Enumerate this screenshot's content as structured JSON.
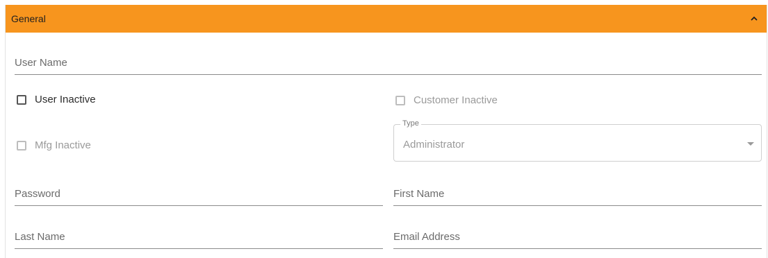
{
  "section": {
    "title": "General",
    "expanded": true,
    "accent_color": "#f7951e"
  },
  "fields": {
    "user_name": {
      "label": "User Name",
      "value": ""
    },
    "password": {
      "label": "Password",
      "value": ""
    },
    "first_name": {
      "label": "First Name",
      "value": ""
    },
    "last_name": {
      "label": "Last Name",
      "value": ""
    },
    "email_address": {
      "label": "Email Address",
      "value": ""
    }
  },
  "checkboxes": {
    "user_inactive": {
      "label": "User Inactive",
      "checked": false,
      "disabled": false
    },
    "customer_inactive": {
      "label": "Customer Inactive",
      "checked": false,
      "disabled": true
    },
    "mfg_inactive": {
      "label": "Mfg Inactive",
      "checked": false,
      "disabled": true
    }
  },
  "type_select": {
    "label": "Type",
    "selected": "Administrator",
    "disabled": true
  },
  "icons": {
    "collapse": "chevron-up-icon",
    "dropdown": "chevron-down-icon"
  }
}
